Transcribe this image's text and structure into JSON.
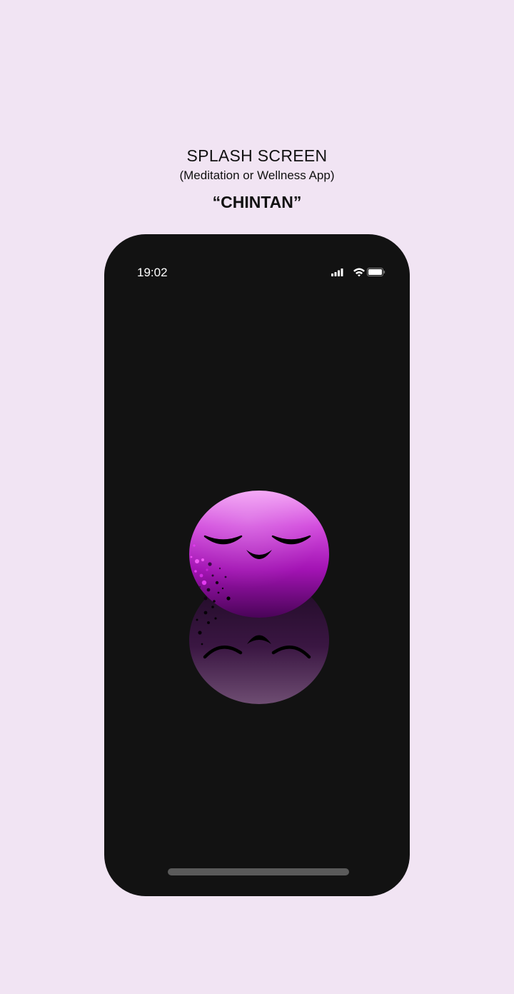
{
  "header": {
    "title": "SPLASH SCREEN",
    "subtitle": "(Meditation or Wellness App)",
    "app_name": "“CHINTAN”"
  },
  "status_bar": {
    "time": "19:02",
    "icons": [
      "signal-icon",
      "wifi-icon",
      "battery-icon"
    ]
  },
  "splash": {
    "logo": "meditating-face-logo",
    "colors": {
      "background": "#121212",
      "orb_top": "#F3A0F5",
      "orb_mid": "#B820C6",
      "orb_bottom": "#4A0458",
      "page_background": "#F1E4F3"
    }
  }
}
